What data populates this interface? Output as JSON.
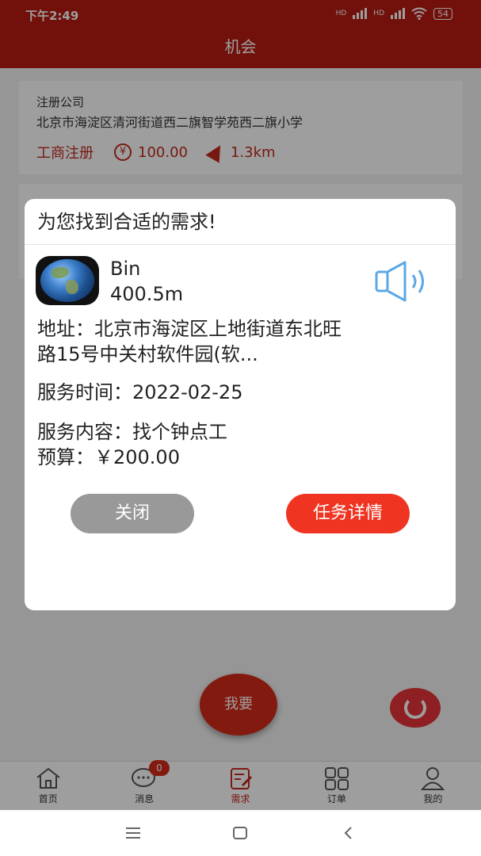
{
  "status_bar": {
    "time": "下午2:49",
    "battery": "54",
    "hd": "HD"
  },
  "header": {
    "title": "机会"
  },
  "cards": [
    {
      "title": "注册公司",
      "address": "北京市海淀区清河街道西二旗智学苑西二旗小学",
      "tag": "工商注册",
      "price": "100.00",
      "distance": "1.3km"
    }
  ],
  "want_button": "我要",
  "dialog": {
    "title": "为您找到合适的需求!",
    "user_name": "Bin",
    "user_distance": "400.5m",
    "address_line1": "地址：北京市海淀区上地街道东北旺",
    "address_line2": "路15号中关村软件园(软...",
    "service_time": "服务时间：2022-02-25",
    "service_content": "服务内容：找个钟点工",
    "budget": "预算：￥200.00",
    "close_label": "关闭",
    "detail_label": "任务详情"
  },
  "tabs": [
    {
      "label": "首页",
      "icon": "home-icon"
    },
    {
      "label": "消息",
      "icon": "message-icon",
      "badge": "0"
    },
    {
      "label": "需求",
      "icon": "demand-icon"
    },
    {
      "label": "订单",
      "icon": "order-grid-icon"
    },
    {
      "label": "我的",
      "icon": "profile-icon"
    }
  ],
  "accent_color": "#b81c12"
}
